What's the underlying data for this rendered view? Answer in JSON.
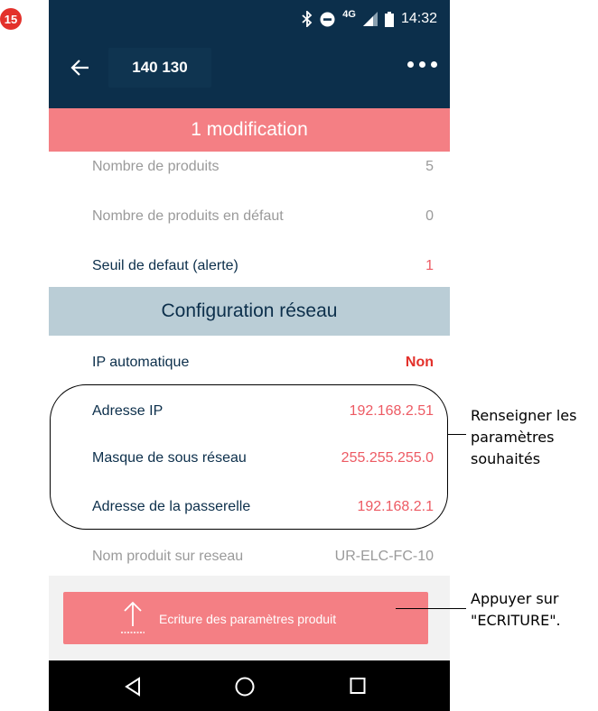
{
  "step": {
    "number": "15"
  },
  "statusbar": {
    "network": "4G",
    "time": "14:32"
  },
  "appbar": {
    "title": "140 130"
  },
  "banner": {
    "modifications": "1 modification"
  },
  "rows": {
    "products_count": {
      "label": "Nombre de produits",
      "value": "5"
    },
    "products_fault": {
      "label": "Nombre de produits en défaut",
      "value": "0"
    },
    "fault_threshold": {
      "label": "Seuil de defaut (alerte)",
      "value": "1"
    },
    "auto_ip": {
      "label": "IP automatique",
      "value": "Non"
    },
    "ip_address": {
      "label": "Adresse IP",
      "value": "192.168.2.51"
    },
    "subnet_mask": {
      "label": "Masque de sous réseau",
      "value": "255.255.255.0"
    },
    "gateway": {
      "label": "Adresse de la passerelle",
      "value": "192.168.2.1"
    },
    "network_name": {
      "label": "Nom produit sur reseau",
      "value": "UR-ELC-FC-10"
    }
  },
  "section": {
    "network_config": "Configuration réseau"
  },
  "write_button": {
    "label": "Ecriture des paramètres produit"
  },
  "callouts": {
    "fill_params": "Renseigner les\nparamètres\nsouhaités",
    "press_write": "Appuyer sur\n\"ECRITURE\"."
  },
  "colors": {
    "primary": "#0c2f4b",
    "accent": "#f47f84",
    "section": "#bacdd6",
    "value_red": "#ed5a63",
    "emphasis_red": "#e3312b"
  },
  "icons": [
    "bluetooth-icon",
    "do-not-disturb-icon",
    "signal-icon",
    "battery-icon",
    "back-arrow-icon",
    "more-dots-icon",
    "upload-icon",
    "nav-back-icon",
    "nav-home-icon",
    "nav-recents-icon"
  ]
}
